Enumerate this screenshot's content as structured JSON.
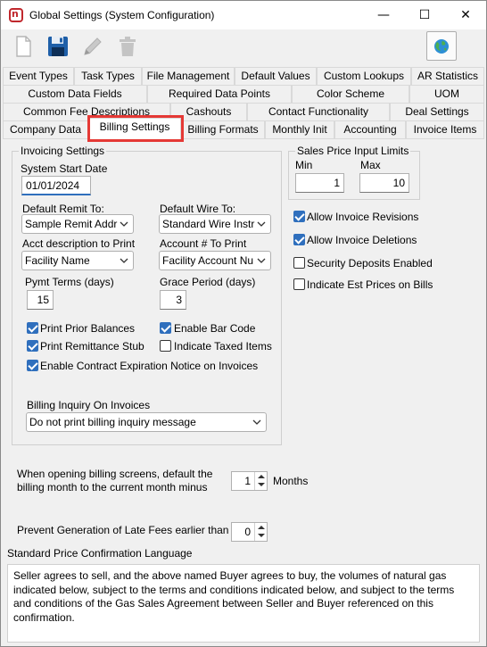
{
  "window": {
    "title": "Global Settings (System Configuration)",
    "minimize": "—",
    "maximize": "☐",
    "close": "✕"
  },
  "toolbar": {
    "new": "new-document-icon",
    "save": "save-icon",
    "edit": "edit-icon",
    "delete": "delete-icon",
    "globe": "globe-icon"
  },
  "tabs": {
    "row1": [
      "Event Types",
      "Task Types",
      "File Management",
      "Default Values",
      "Custom Lookups",
      "AR Statistics"
    ],
    "row2": [
      "Custom Data Fields",
      "Required Data Points",
      "Color Scheme",
      "UOM"
    ],
    "row3": [
      "Common Fee Descriptions",
      "Cashouts",
      "Contact Functionality",
      "Deal Settings"
    ],
    "row4": [
      "Company Data",
      "Billing Settings",
      "Billing Formats",
      "Monthly Init",
      "Accounting",
      "Invoice Items"
    ],
    "active": "Billing Settings"
  },
  "invoicing": {
    "group_title": "Invoicing Settings",
    "start_date_label": "System Start Date",
    "start_date": "01/01/2024",
    "remit_label": "Default Remit To:",
    "remit_value": "Sample Remit Addr",
    "wire_label": "Default Wire To:",
    "wire_value": "Standard Wire Instr",
    "acct_desc_label": "Acct description to Print",
    "acct_desc_value": "Facility Name",
    "acct_num_label": "Account # To Print",
    "acct_num_value": "Facility Account Nu",
    "pymt_terms_label": "Pymt Terms (days)",
    "pymt_terms_value": "15",
    "grace_label": "Grace Period (days)",
    "grace_value": "3",
    "print_prior_balances": {
      "label": "Print Prior Balances",
      "checked": true
    },
    "enable_bar_code": {
      "label": "Enable Bar Code",
      "checked": true
    },
    "print_remittance_stub": {
      "label": "Print Remittance Stub",
      "checked": true
    },
    "indicate_taxed_items": {
      "label": "Indicate Taxed Items",
      "checked": false
    },
    "contract_expiration": {
      "label": "Enable Contract Expiration Notice on Invoices",
      "checked": true
    },
    "billing_inquiry_label": "Billing Inquiry On Invoices",
    "billing_inquiry_value": "Do not print billing inquiry message"
  },
  "sales_price": {
    "group_title": "Sales Price Input Limits",
    "min_label": "Min",
    "min_value": "1",
    "max_label": "Max",
    "max_value": "10"
  },
  "options": {
    "allow_revisions": {
      "label": "Allow Invoice Revisions",
      "checked": true
    },
    "allow_deletions": {
      "label": "Allow Invoice Deletions",
      "checked": true
    },
    "security_deposits": {
      "label": "Security Deposits Enabled",
      "checked": false
    },
    "est_prices": {
      "label": "Indicate Est Prices on Bills",
      "checked": false
    }
  },
  "billing_month": {
    "label_line1": "When opening billing screens, default the",
    "label_line2": "billing month to the current month minus",
    "value": "1",
    "unit": "Months"
  },
  "late_fees": {
    "label": "Prevent Generation of Late Fees earlier than",
    "value": "0"
  },
  "price_confirmation": {
    "label": "Standard Price Confirmation Language",
    "text": "Seller agrees to sell, and the above named Buyer agrees to buy, the volumes of natural gas indicated below, subject to the terms and conditions indicated below, and subject to the terms and conditions of the Gas Sales Agreement between Seller and Buyer referenced on this confirmation."
  }
}
